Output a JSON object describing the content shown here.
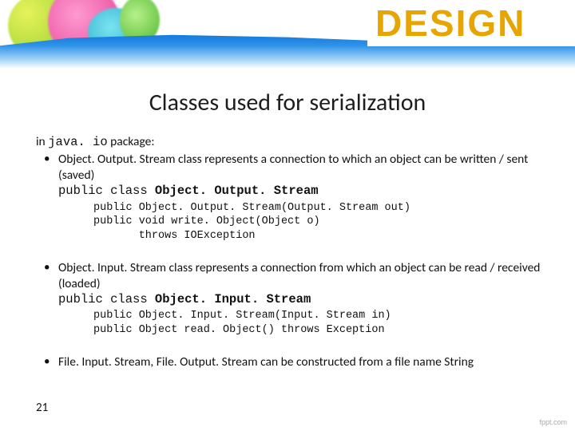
{
  "banner": {
    "design_text": "DESIGN"
  },
  "title": "Classes used for serialization",
  "intro": {
    "prefix": "in ",
    "package": "java. io",
    "suffix": " package:"
  },
  "bullet1": {
    "text": "Object. Output. Stream class represents a connection to which an object can be written / sent (saved)",
    "decl_prefix": "public class ",
    "decl_class": "Object. Output. Stream",
    "code": "public Object. Output. Stream(Output. Stream out)\npublic void write. Object(Object o)\n       throws IOException"
  },
  "bullet2": {
    "text": "Object. Input. Stream class represents a connection from which an object can be read / received (loaded)",
    "decl_prefix": "public class ",
    "decl_class": "Object. Input. Stream",
    "code": "public Object. Input. Stream(Input. Stream in)\npublic Object read. Object() throws Exception"
  },
  "bullet3": {
    "text": "File. Input. Stream, File. Output. Stream can be constructed from a file name String"
  },
  "pagenum": "21",
  "credit": "fppt.com"
}
